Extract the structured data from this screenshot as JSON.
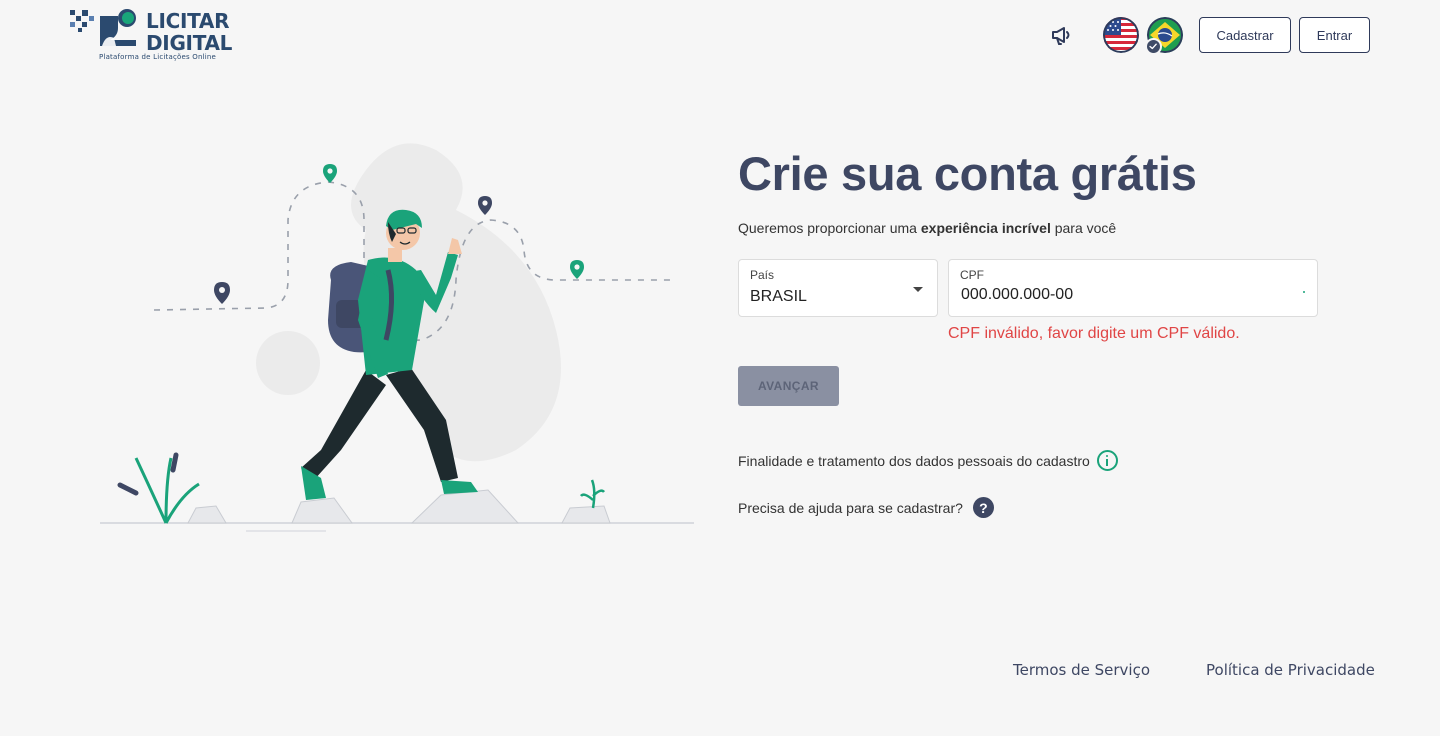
{
  "header": {
    "logo_title_line1": "LICITAR",
    "logo_title_line2": "DIGITAL",
    "logo_subtitle": "Plataforma de Licitações Online",
    "register_label": "Cadastrar",
    "login_label": "Entrar",
    "icons": [
      "megaphone-icon",
      "us-flag-icon",
      "brazil-flag-icon",
      "check-icon"
    ]
  },
  "main": {
    "title_regular": "Crie sua conta ",
    "title_bold": "grátis",
    "subtitle_pre": "Queremos proporcionar uma ",
    "subtitle_bold": "experiência incrível",
    "subtitle_post": " para você",
    "country": {
      "label": "País",
      "value": "BRASIL"
    },
    "cpf": {
      "label": "CPF",
      "value": "000.000.000-00"
    },
    "error": "CPF inválido, favor digite um CPF válido.",
    "advance_label": "AVANÇAR",
    "data_purpose_text": "Finalidade e tratamento dos dados pessoais do cadastro",
    "help_text": "Precisa de ajuda para se cadastrar?",
    "help_icon_glyph": "?"
  },
  "footer": {
    "terms": "Termos de Serviço",
    "privacy": "Política de Privacidade"
  },
  "colors": {
    "background": "#f6f6f6",
    "brand_navy": "#2b4a6f",
    "title": "#3e4763",
    "accent_green": "#1aa37a",
    "error": "#e04545",
    "button_disabled": "#8a90a2"
  }
}
